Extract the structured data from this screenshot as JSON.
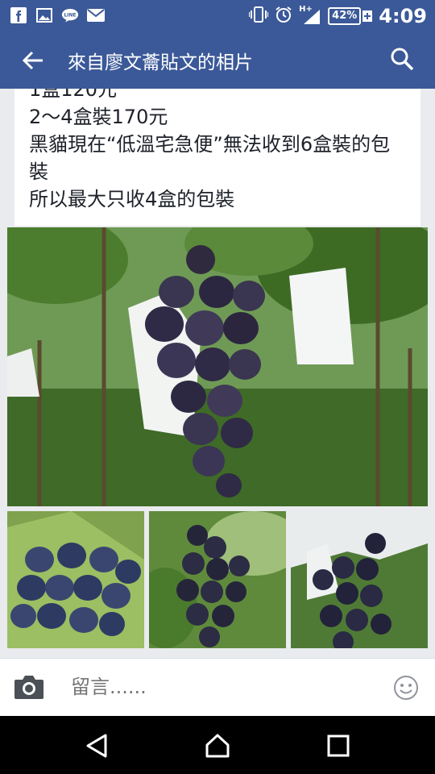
{
  "status_bar": {
    "icons": [
      "facebook-icon",
      "gallery-icon",
      "line-icon",
      "mail-icon",
      "vibrate-icon",
      "alarm-icon",
      "signal-icon"
    ],
    "signal_label": "H+",
    "battery": "42%",
    "time": "4:09"
  },
  "app_bar": {
    "title": "來自廖文蘥貼文的相片"
  },
  "post": {
    "text": "1盒120元\n2～4盒裝170元\n黑貓現在“低溫宅急便”無法收到6盒裝的包裝\n所以最大只收4盒的包裝"
  },
  "comment_bar": {
    "placeholder": "留言......"
  },
  "colors": {
    "brand_blue": "#3b5998",
    "nav_black": "#000000"
  }
}
